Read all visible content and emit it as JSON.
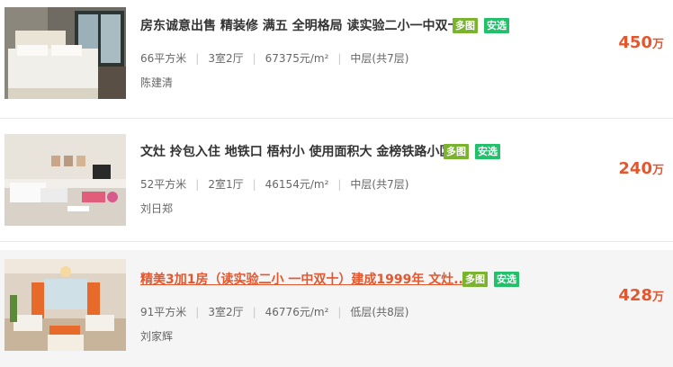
{
  "listings": [
    {
      "title": "房东诚意出售 精装修 满五 全明格局 读实验二小一中双十",
      "tags": [
        "多图",
        "安选"
      ],
      "area": "66平方米",
      "layout": "3室2厅",
      "unit_price": "67375元/m²",
      "floor": "中层(共7层)",
      "agent": "陈建清",
      "price": "450",
      "price_unit": "万"
    },
    {
      "title": "文灶 拎包入住 地铁口 梧村小 使用面积大 金榜铁路小区",
      "tags": [
        "多图",
        "安选"
      ],
      "area": "52平方米",
      "layout": "2室1厅",
      "unit_price": "46154元/m²",
      "floor": "中层(共7层)",
      "agent": "刘日郑",
      "price": "240",
      "price_unit": "万"
    },
    {
      "title": "精美3加1房（读实验二小 一中双十）建成1999年 文灶...",
      "tags": [
        "多图",
        "安选"
      ],
      "area": "91平方米",
      "layout": "3室2厅",
      "unit_price": "46776元/m²",
      "floor": "低层(共8层)",
      "agent": "刘家辉",
      "price": "428",
      "price_unit": "万"
    }
  ]
}
